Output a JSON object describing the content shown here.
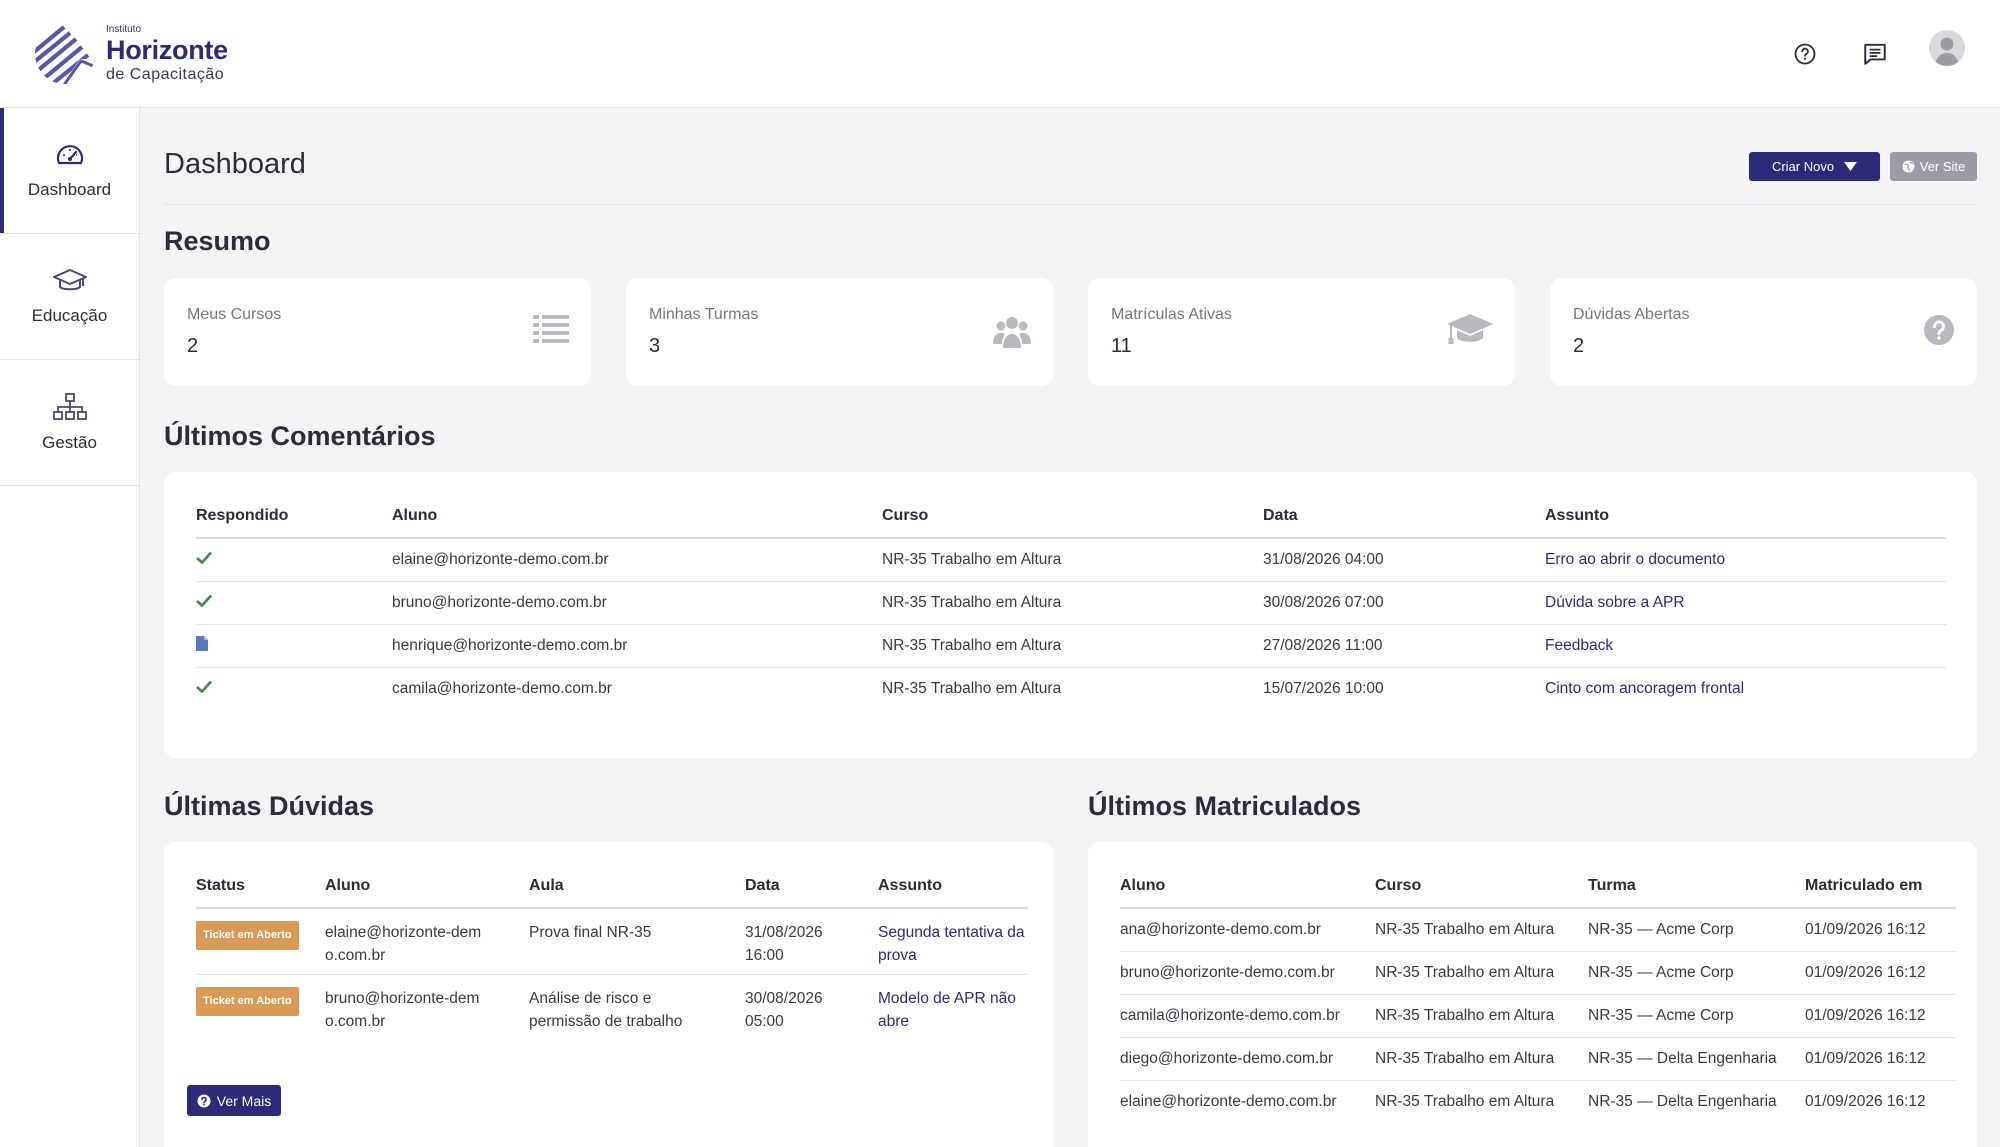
{
  "brand": {
    "small": "Instituto",
    "name": "Horizonte",
    "sub": "de Capacitação",
    "accent": "#2e2a7a"
  },
  "header": {
    "icons": [
      "help-circle-icon",
      "chat-icon"
    ],
    "avatar": "user-avatar"
  },
  "sidebar": {
    "items": [
      {
        "label": "Dashboard",
        "icon": "speedometer-icon",
        "active": true
      },
      {
        "label": "Educação",
        "icon": "graduation-cap-icon",
        "active": false
      },
      {
        "label": "Gestão",
        "icon": "org-chart-icon",
        "active": false
      }
    ]
  },
  "page": {
    "title": "Dashboard",
    "create_label": "Criar Novo",
    "site_label": "Ver Site"
  },
  "summary": {
    "title": "Resumo",
    "cards": [
      {
        "label": "Meus Cursos",
        "value": "2",
        "icon": "list-icon"
      },
      {
        "label": "Minhas Turmas",
        "value": "3",
        "icon": "users-icon"
      },
      {
        "label": "Matrículas Ativas",
        "value": "11",
        "icon": "graduation-cap-icon"
      },
      {
        "label": "Dúvidas Abertas",
        "value": "2",
        "icon": "question-circle-icon"
      }
    ]
  },
  "comments": {
    "title": "Últimos Comentários",
    "headers": [
      "Respondido",
      "Aluno",
      "Curso",
      "Data",
      "Assunto"
    ],
    "rows": [
      {
        "status": "check",
        "aluno": "elaine@horizonte-demo.com.br",
        "curso": "NR-35 Trabalho em Altura",
        "data": "31/08/2026 04:00",
        "assunto": "Erro ao abrir o documento"
      },
      {
        "status": "check",
        "aluno": "bruno@horizonte-demo.com.br",
        "curso": "NR-35 Trabalho em Altura",
        "data": "30/08/2026 07:00",
        "assunto": "Dúvida sobre a APR"
      },
      {
        "status": "file",
        "aluno": "henrique@horizonte-demo.com.br",
        "curso": "NR-35 Trabalho em Altura",
        "data": "27/08/2026 11:00",
        "assunto": "Feedback"
      },
      {
        "status": "check",
        "aluno": "camila@horizonte-demo.com.br",
        "curso": "NR-35 Trabalho em Altura",
        "data": "15/07/2026 10:00",
        "assunto": "Cinto com ancoragem frontal"
      }
    ]
  },
  "doubts": {
    "title": "Últimas Dúvidas",
    "headers": [
      "Status",
      "Aluno",
      "Aula",
      "Data",
      "Assunto"
    ],
    "rows": [
      {
        "status": "Ticket em Aberto",
        "aluno": "elaine@horizonte-demo.com.br",
        "aula": "Prova final NR-35",
        "data": "31/08/2026 16:00",
        "assunto": "Segunda tentativa da prova"
      },
      {
        "status": "Ticket em Aberto",
        "aluno": "bruno@horizonte-demo.com.br",
        "aula": "Análise de risco e permissão de trabalho",
        "data": "30/08/2026 05:00",
        "assunto": "Modelo de APR não abre"
      }
    ],
    "more_label": "Ver Mais",
    "badge_color": "#d89a56"
  },
  "enrolled": {
    "title": "Últimos Matriculados",
    "headers": [
      "Aluno",
      "Curso",
      "Turma",
      "Matriculado em"
    ],
    "rows": [
      {
        "aluno": "ana@horizonte-demo.com.br",
        "curso": "NR-35 Trabalho em Altura",
        "turma": "NR-35 — Acme Corp",
        "data": "01/09/2026 16:12"
      },
      {
        "aluno": "bruno@horizonte-demo.com.br",
        "curso": "NR-35 Trabalho em Altura",
        "turma": "NR-35 — Acme Corp",
        "data": "01/09/2026 16:12"
      },
      {
        "aluno": "camila@horizonte-demo.com.br",
        "curso": "NR-35 Trabalho em Altura",
        "turma": "NR-35 — Acme Corp",
        "data": "01/09/2026 16:12"
      },
      {
        "aluno": "diego@horizonte-demo.com.br",
        "curso": "NR-35 Trabalho em Altura",
        "turma": "NR-35 — Delta Engenharia",
        "data": "01/09/2026 16:12"
      },
      {
        "aluno": "elaine@horizonte-demo.com.br",
        "curso": "NR-35 Trabalho em Altura",
        "turma": "NR-35 — Delta Engenharia",
        "data": "01/09/2026 16:12"
      }
    ]
  }
}
